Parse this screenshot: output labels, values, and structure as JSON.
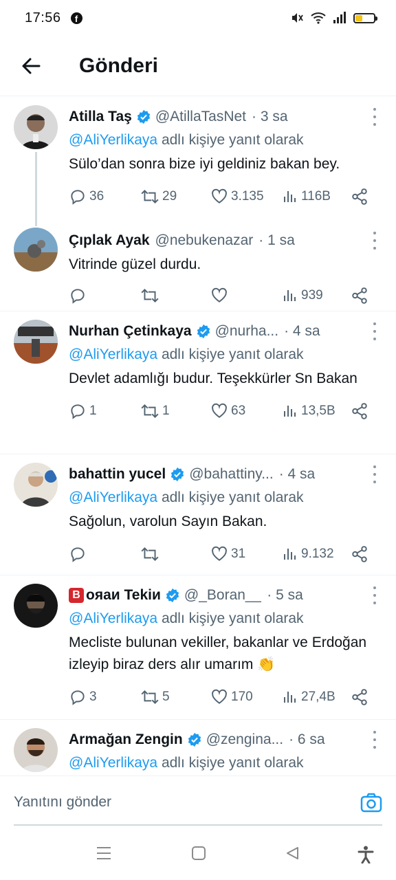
{
  "status_bar": {
    "time": "17:56",
    "icons": [
      "facebook-icon",
      "mute-icon",
      "wifi-icon",
      "signal-icon",
      "battery-icon"
    ],
    "battery_color": "#f3c316"
  },
  "header": {
    "title": "Gönderi"
  },
  "colors": {
    "accent": "#1d9bf0",
    "secondary_text": "#536471",
    "verified": "#1d9bf0"
  },
  "reply_prefix": "adlı kişiye yanıt olarak",
  "tweets": [
    {
      "name": "Atilla Taş",
      "verified": true,
      "handle": "@AtillaTasNet",
      "time": "· 3 sa",
      "mention": "@AliYerlikaya",
      "text": "Sülo’dan sonra bize iyi geldiniz bakan bey.",
      "replies": "36",
      "retweets": "29",
      "likes": "3.135",
      "views": "116B"
    },
    {
      "name": "Çıplak Ayak",
      "verified": false,
      "handle": "@nebukenazar",
      "time": "· 1 sa",
      "text": "Vitrinde güzel durdu.",
      "replies": "",
      "retweets": "",
      "likes": "",
      "views": "939"
    },
    {
      "name": "Nurhan Çetinkaya",
      "verified": true,
      "handle": "@nurha...",
      "time": "· 4 sa",
      "mention": "@AliYerlikaya",
      "text": "Devlet adamlığı budur. Teşekkürler Sn Bakan",
      "replies": "1",
      "retweets": "1",
      "likes": "63",
      "views": "13,5B"
    },
    {
      "name": "bahattin yucel",
      "verified": true,
      "handle": "@bahattiny...",
      "time": "· 4 sa",
      "mention": "@AliYerlikaya",
      "text": "Sağolun, varolun Sayın Bakan.",
      "replies": "",
      "retweets": "",
      "likes": "31",
      "views": "9.132"
    },
    {
      "name_badge": "B",
      "name": "oяaи Tekiи",
      "verified": true,
      "handle": "@_Boran__",
      "time": "· 5 sa",
      "mention": "@AliYerlikaya",
      "text": "Mecliste bulunan vekiller, bakanlar ve Erdoğan izleyip biraz ders alır umarım 👏",
      "replies": "3",
      "retweets": "5",
      "likes": "170",
      "views": "27,4B"
    },
    {
      "name": "Armağan Zengin",
      "verified": true,
      "handle": "@zengina...",
      "time": "· 6 sa",
      "mention": "@AliYerlikaya"
    }
  ],
  "reply_bar": {
    "placeholder": "Yanıtını gönder"
  },
  "nav_bar": {
    "buttons": [
      "recents-icon",
      "home-icon",
      "back-icon",
      "accessibility-icon"
    ]
  }
}
